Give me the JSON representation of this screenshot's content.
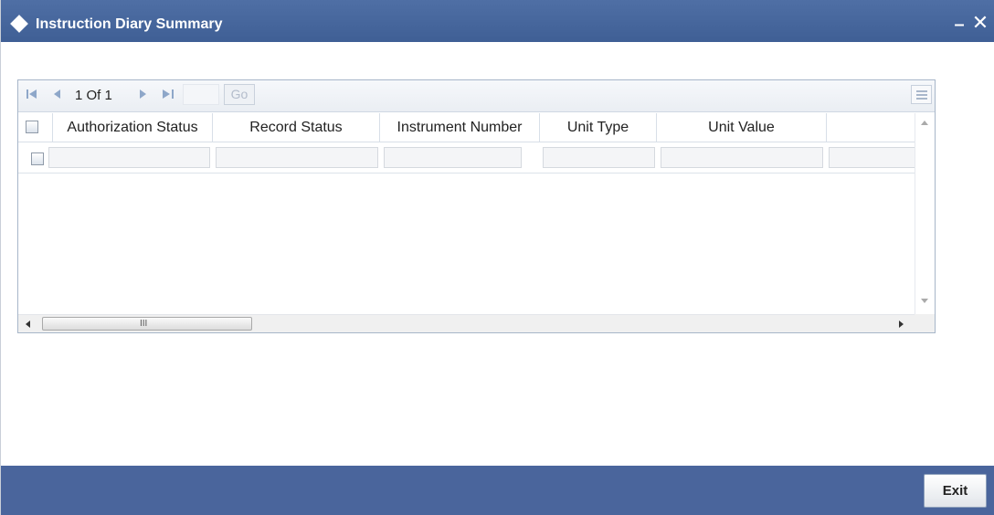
{
  "window": {
    "title": "Instruction Diary Summary",
    "minimize_glyph": "–",
    "close_glyph": "✕"
  },
  "pager": {
    "current_page": "1",
    "of_label": "Of",
    "total_pages": "1",
    "page_input_value": "",
    "go_label": "Go",
    "icons": [
      "first-page-icon",
      "previous-page-icon",
      "next-page-icon",
      "last-page-icon",
      "column-settings-icon"
    ]
  },
  "table": {
    "columns": [
      "Authorization Status",
      "Record Status",
      "Instrument Number",
      "Unit Type",
      "Unit Value"
    ],
    "rows": [
      [
        "",
        "",
        "",
        "",
        ""
      ]
    ]
  },
  "scrollbar": {
    "thumb_grip": "III"
  },
  "footer": {
    "exit_label": "Exit"
  },
  "colors": {
    "titlebar": "#4f6fa5",
    "footer": "#4a659c",
    "panel_border": "#a7b6c9",
    "pager_icons": "#8ea7c9"
  }
}
